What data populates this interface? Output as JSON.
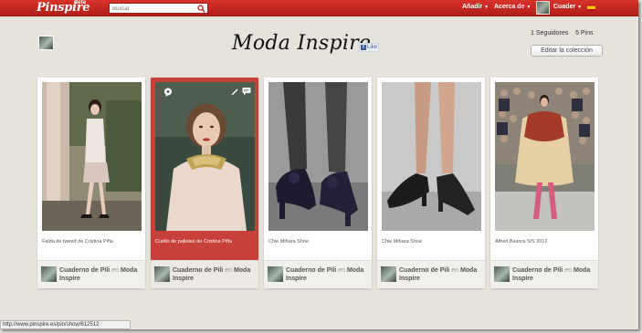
{
  "header": {
    "logo": "Pinspire",
    "beta": "Beta",
    "search_placeholder": "Buscar",
    "nav": {
      "add_label": "Añadir",
      "about_label": "Acerca de",
      "user_label": "Cuader"
    }
  },
  "board": {
    "title": "Moda Inspire",
    "like_label": "Like",
    "followers_count": "1",
    "followers_label": "Seguidores",
    "pins_count": "5",
    "pins_label": "Pins",
    "edit_label": "Editar la colección"
  },
  "pins": [
    {
      "description": "Falda de tweed de Cristina Piña",
      "user": "Cuaderno de Pili",
      "en": "en",
      "board": "Moda Inspire"
    },
    {
      "description": "Cuello de palletes de Cristina Piña",
      "user": "Cuaderno de Pili",
      "en": "en",
      "board": "Moda Inspire"
    },
    {
      "description": "Chie Mihara Shoe",
      "user": "Cuaderno de Pili",
      "en": "en",
      "board": "Moda Inspire"
    },
    {
      "description": "Chie Mihara Shoe",
      "user": "Cuaderno de Pili",
      "en": "en",
      "board": "Moda Inspire"
    },
    {
      "description": "Alfred Besora S/S 2012",
      "user": "Cuaderno de Pili",
      "en": "en",
      "board": "Moda Inspire"
    }
  ],
  "status_url": "http://www.pinspire.es/pin/show/612512",
  "colors": {
    "topbar": "#c9281f",
    "active_pin": "#c8403a",
    "background": "#e6e2dc"
  }
}
